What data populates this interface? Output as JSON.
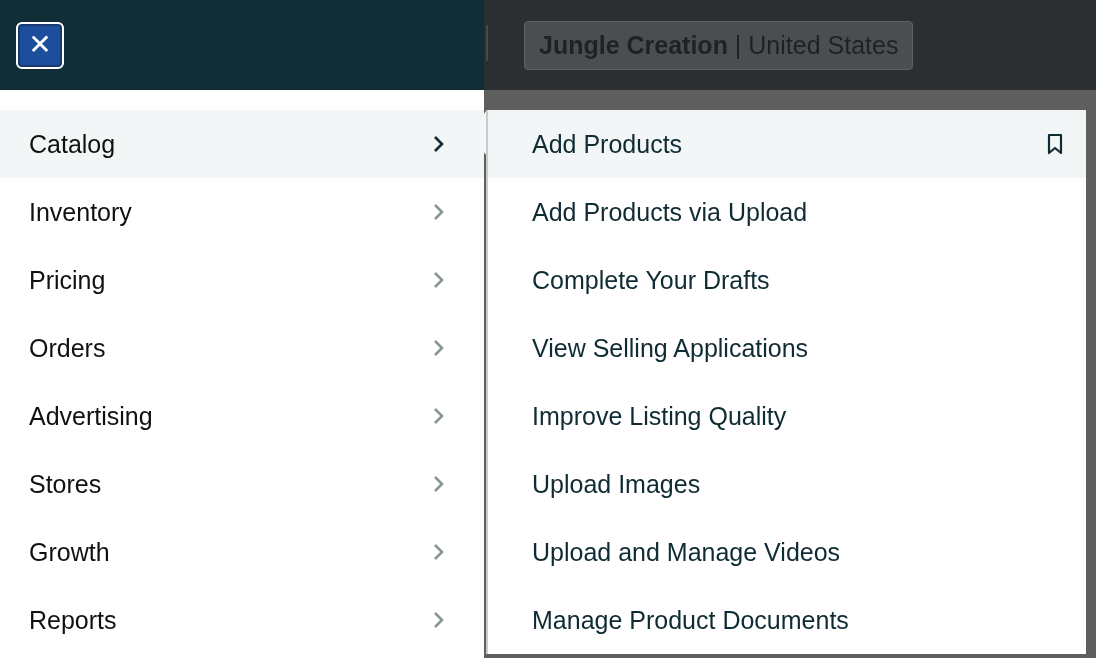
{
  "header": {
    "close_button": "✕",
    "account": "**Jungle Creation** | United States"
  },
  "menu": [
    {
      "label": "Catalog",
      "selected": true
    },
    {
      "label": "Inventory",
      "selected": false
    },
    {
      "label": "Pricing",
      "selected": false
    },
    {
      "label": "Orders",
      "selected": false
    },
    {
      "label": "Advertising",
      "selected": false
    },
    {
      "label": "Stores",
      "selected": false
    },
    {
      "label": "Growth",
      "selected": false
    },
    {
      "label": "Reports",
      "selected": false
    }
  ],
  "submenu": [
    {
      "label": "Add Products",
      "selected": true
    },
    {
      "label": "Add Products via Upload",
      "selected": false
    },
    {
      "label": "Complete Your Drafts",
      "selected": false
    },
    {
      "label": "View Selling Applications",
      "selected": false
    },
    {
      "label": "Improve Listing Quality",
      "selected": false
    },
    {
      "label": "Upload Images",
      "selected": false
    },
    {
      "label": "Upload and Manage Videos",
      "selected": false
    },
    {
      "label": "Manage Product Documents",
      "selected": false
    }
  ]
}
